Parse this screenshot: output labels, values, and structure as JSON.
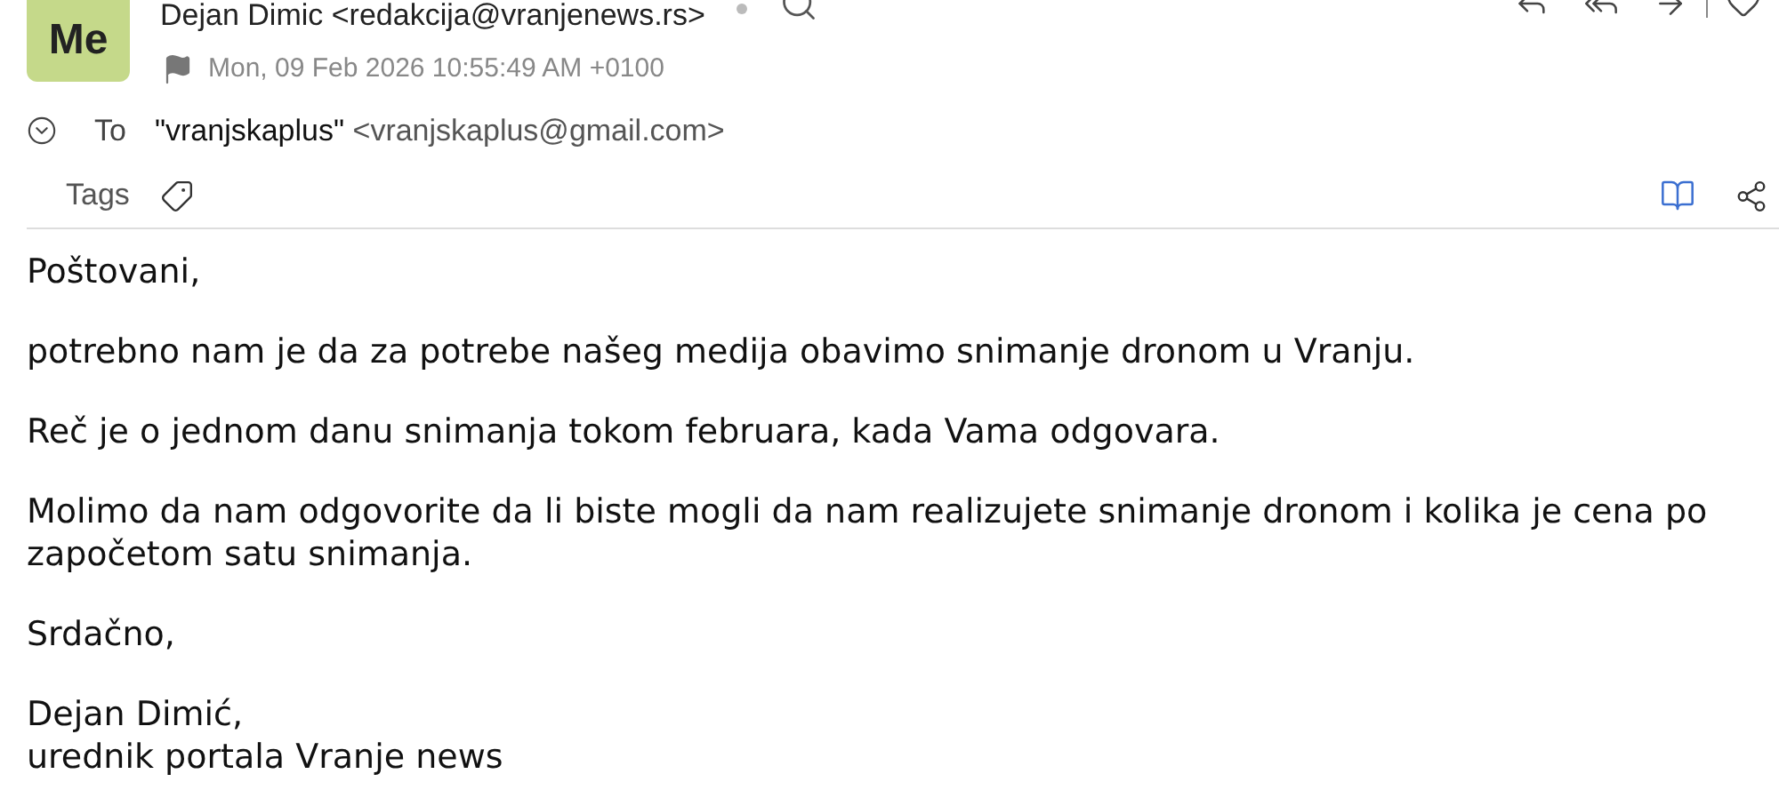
{
  "avatar": {
    "initials": "Me"
  },
  "sender": {
    "name": "Dejan Dimic",
    "address": "<redakcija@vranjenews.rs>"
  },
  "flagged": false,
  "date": "Mon, 09 Feb 2026 10:55:49 AM +0100",
  "to": {
    "label": "To",
    "name": "\"vranjskaplus\"",
    "address": "<vranjskaplus@gmail.com>"
  },
  "tags": {
    "label": "Tags"
  },
  "body": [
    "Poštovani,",
    "potrebno nam je da za potrebe našeg medija obavimo snimanje dronom u Vranju.",
    "Reč je o jednom danu snimanja tokom februara, kada Vama odgovara.",
    "Molimo da nam odgovorite da li biste mogli da nam realizujete snimanje dronom i kolika je cena po započetom satu snimanja.",
    "Srdačno,",
    "Dejan Dimić,\nurednik portala Vranje news"
  ]
}
